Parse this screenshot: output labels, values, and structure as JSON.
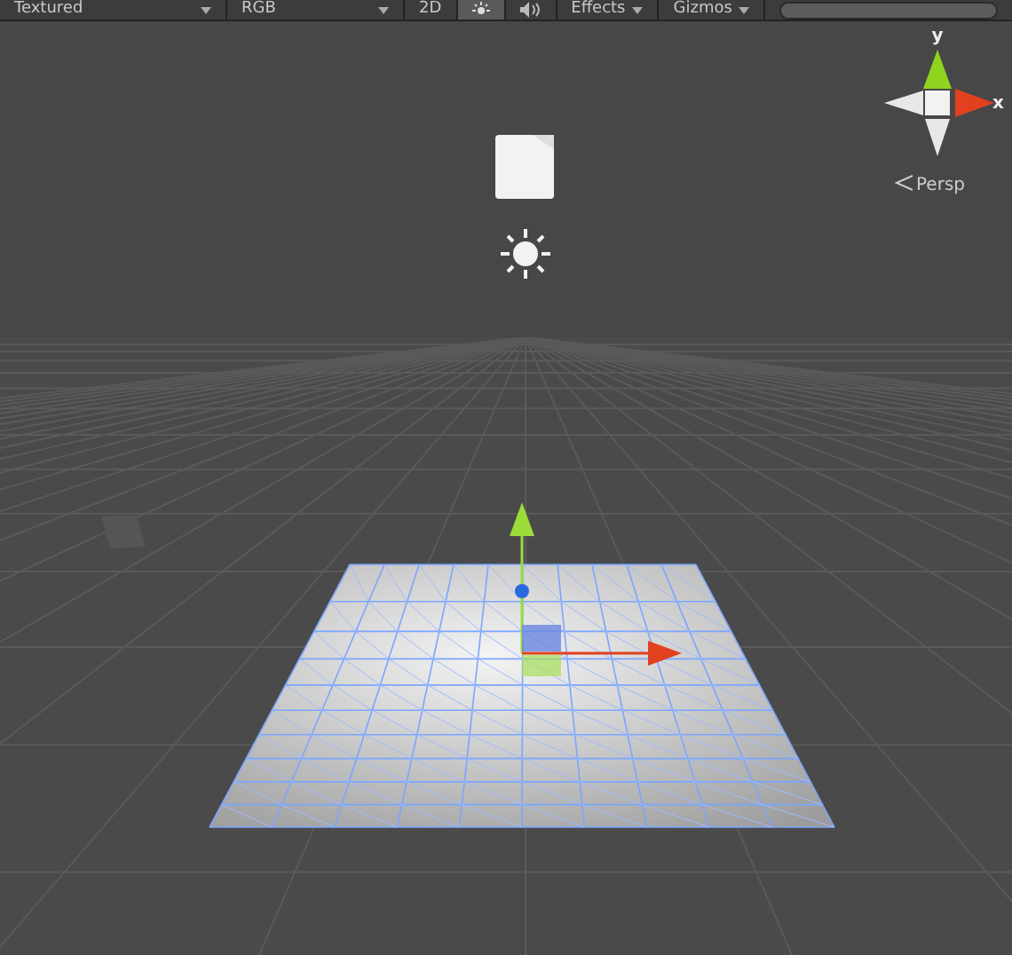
{
  "toolbar": {
    "items": [
      {
        "kind": "dropdown",
        "label": "Textured",
        "selected": false
      },
      {
        "kind": "dropdown",
        "label": "RGB",
        "selected": false
      },
      {
        "kind": "toggle",
        "label": "2D",
        "selected": false
      },
      {
        "kind": "light",
        "selected": true
      },
      {
        "kind": "audio",
        "selected": false
      },
      {
        "kind": "dropdown",
        "label": "Effects",
        "selected": false
      },
      {
        "kind": "dropdown",
        "label": "Gizmos",
        "selected": false
      },
      {
        "kind": "search"
      }
    ]
  },
  "orientation_gizmo": {
    "y_label": "y",
    "x_label": "x",
    "projection": "Persp"
  }
}
